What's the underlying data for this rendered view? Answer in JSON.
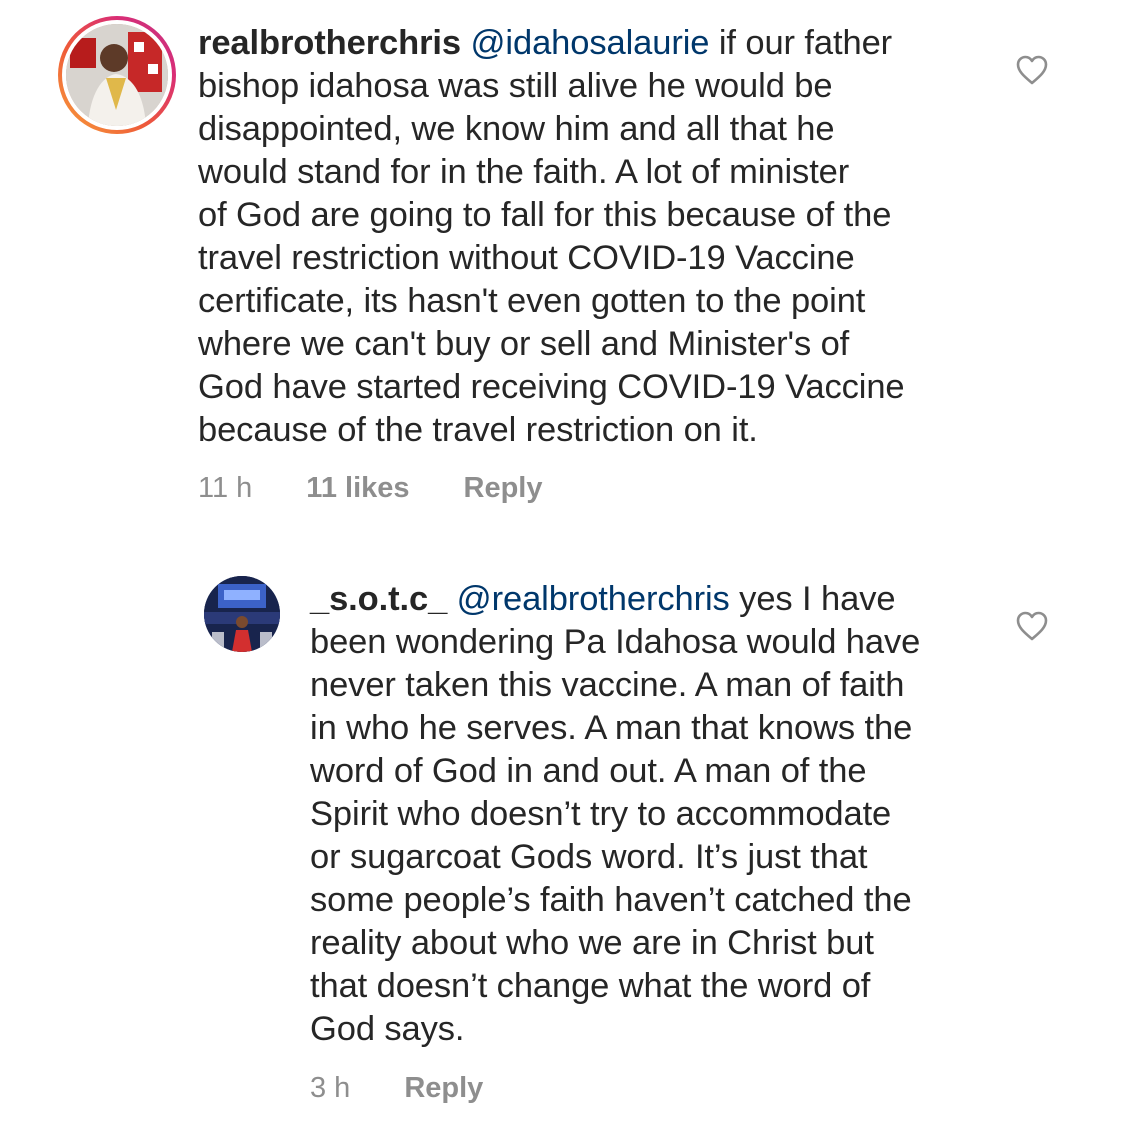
{
  "comments": [
    {
      "username": "realbrotherchris",
      "mention": "@idahosalaurie",
      "body": " if our father\nbishop idahosa was still alive he would be\ndisappointed, we know him and all that he\nwould stand for in the faith. A lot of minister\nof God are going to fall for this because of the\ntravel restriction without COVID-19 Vaccine\ncertificate, its hasn't even gotten to the point\nwhere we can't buy or sell and Minister's of\nGod have started receiving COVID-19 Vaccine\nbecause of the travel restriction on it.",
      "time": "11 h",
      "likes": "11 likes",
      "reply_label": "Reply",
      "like_icon": "heart-outline-icon",
      "avatar_ring_color": "#e1306c"
    },
    {
      "username": "_s.o.t.c_",
      "mention": "@realbrotherchris",
      "body": " yes I have\nbeen wondering Pa Idahosa would have\nnever taken this vaccine. A man of faith\nin who he serves. A man that knows the\nword of God in and out. A man of the\nSpirit who doesn’t try to accommodate\nor sugarcoat Gods word. It’s just that\nsome people’s faith haven’t catched the\nreality about who we are in Christ but\nthat doesn’t change what the word of\nGod says.",
      "time": "3 h",
      "reply_label": "Reply",
      "like_icon": "heart-outline-icon"
    }
  ]
}
